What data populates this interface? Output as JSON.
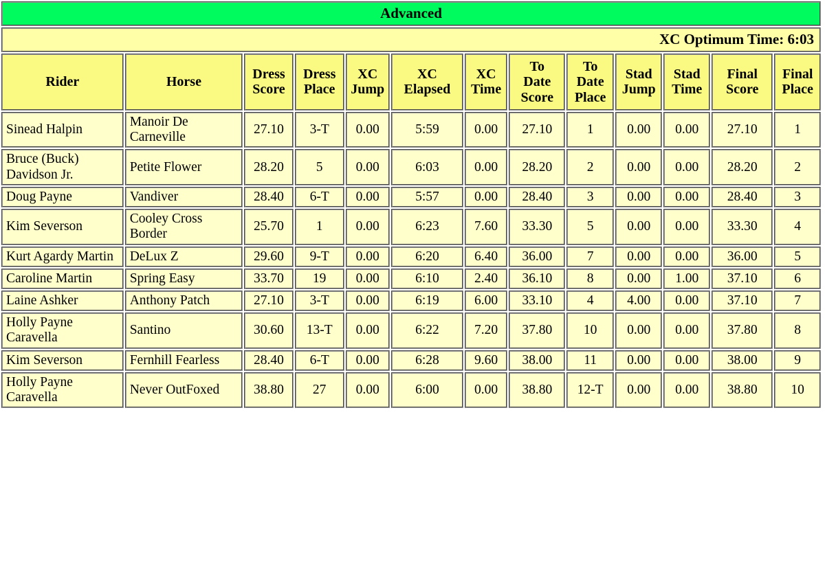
{
  "banner": {
    "division": "Advanced"
  },
  "optimum": {
    "label": "XC Optimum Time: 6:03"
  },
  "table": {
    "columns": [
      "Rider",
      "Horse",
      "Dress Score",
      "Dress Place",
      "XC Jump",
      "XC Elapsed",
      "XC Time",
      "To Date Score",
      "To Date Place",
      "Stad Jump",
      "Stad Time",
      "Final Score",
      "Final Place"
    ],
    "columns_display": [
      {
        "line1": "Rider",
        "line2": ""
      },
      {
        "line1": "Horse",
        "line2": ""
      },
      {
        "line1": "Dress",
        "line2": "Score"
      },
      {
        "line1": "Dress",
        "line2": "Place"
      },
      {
        "line1": "XC",
        "line2": "Jump"
      },
      {
        "line1": "XC",
        "line2": "Elapsed"
      },
      {
        "line1": "XC",
        "line2": "Time"
      },
      {
        "line1": "To",
        "line2": "Date",
        "line3": "Score"
      },
      {
        "line1": "To",
        "line2": "Date",
        "line3": "Place"
      },
      {
        "line1": "Stad",
        "line2": "Jump"
      },
      {
        "line1": "Stad",
        "line2": "Time"
      },
      {
        "line1": "Final",
        "line2": "Score"
      },
      {
        "line1": "Final",
        "line2": "Place"
      }
    ],
    "rows": [
      {
        "rider": "Sinead Halpin",
        "horse": "Manoir De Carneville",
        "dress_score": "27.10",
        "dress_place": "3-T",
        "xc_jump": "0.00",
        "xc_elapsed": "5:59",
        "xc_time": "0.00",
        "to_date_score": "27.10",
        "to_date_place": "1",
        "stad_jump": "0.00",
        "stad_time": "0.00",
        "final_score": "27.10",
        "final_place": "1"
      },
      {
        "rider": "Bruce (Buck) Davidson Jr.",
        "horse": "Petite Flower",
        "dress_score": "28.20",
        "dress_place": "5",
        "xc_jump": "0.00",
        "xc_elapsed": "6:03",
        "xc_time": "0.00",
        "to_date_score": "28.20",
        "to_date_place": "2",
        "stad_jump": "0.00",
        "stad_time": "0.00",
        "final_score": "28.20",
        "final_place": "2"
      },
      {
        "rider": "Doug Payne",
        "horse": "Vandiver",
        "dress_score": "28.40",
        "dress_place": "6-T",
        "xc_jump": "0.00",
        "xc_elapsed": "5:57",
        "xc_time": "0.00",
        "to_date_score": "28.40",
        "to_date_place": "3",
        "stad_jump": "0.00",
        "stad_time": "0.00",
        "final_score": "28.40",
        "final_place": "3"
      },
      {
        "rider": "Kim Severson",
        "horse": "Cooley Cross Border",
        "dress_score": "25.70",
        "dress_place": "1",
        "xc_jump": "0.00",
        "xc_elapsed": "6:23",
        "xc_time": "7.60",
        "to_date_score": "33.30",
        "to_date_place": "5",
        "stad_jump": "0.00",
        "stad_time": "0.00",
        "final_score": "33.30",
        "final_place": "4"
      },
      {
        "rider": "Kurt Agardy Martin",
        "horse": "DeLux Z",
        "dress_score": "29.60",
        "dress_place": "9-T",
        "xc_jump": "0.00",
        "xc_elapsed": "6:20",
        "xc_time": "6.40",
        "to_date_score": "36.00",
        "to_date_place": "7",
        "stad_jump": "0.00",
        "stad_time": "0.00",
        "final_score": "36.00",
        "final_place": "5"
      },
      {
        "rider": "Caroline Martin",
        "horse": "Spring Easy",
        "dress_score": "33.70",
        "dress_place": "19",
        "xc_jump": "0.00",
        "xc_elapsed": "6:10",
        "xc_time": "2.40",
        "to_date_score": "36.10",
        "to_date_place": "8",
        "stad_jump": "0.00",
        "stad_time": "1.00",
        "final_score": "37.10",
        "final_place": "6"
      },
      {
        "rider": "Laine Ashker",
        "horse": "Anthony Patch",
        "dress_score": "27.10",
        "dress_place": "3-T",
        "xc_jump": "0.00",
        "xc_elapsed": "6:19",
        "xc_time": "6.00",
        "to_date_score": "33.10",
        "to_date_place": "4",
        "stad_jump": "4.00",
        "stad_time": "0.00",
        "final_score": "37.10",
        "final_place": "7"
      },
      {
        "rider": "Holly Payne Caravella",
        "horse": "Santino",
        "dress_score": "30.60",
        "dress_place": "13-T",
        "xc_jump": "0.00",
        "xc_elapsed": "6:22",
        "xc_time": "7.20",
        "to_date_score": "37.80",
        "to_date_place": "10",
        "stad_jump": "0.00",
        "stad_time": "0.00",
        "final_score": "37.80",
        "final_place": "8"
      },
      {
        "rider": "Kim Severson",
        "horse": "Fernhill Fearless",
        "dress_score": "28.40",
        "dress_place": "6-T",
        "xc_jump": "0.00",
        "xc_elapsed": "6:28",
        "xc_time": "9.60",
        "to_date_score": "38.00",
        "to_date_place": "11",
        "stad_jump": "0.00",
        "stad_time": "0.00",
        "final_score": "38.00",
        "final_place": "9"
      },
      {
        "rider": "Holly Payne Caravella",
        "horse": "Never OutFoxed",
        "dress_score": "38.80",
        "dress_place": "27",
        "xc_jump": "0.00",
        "xc_elapsed": "6:00",
        "xc_time": "0.00",
        "to_date_score": "38.80",
        "to_date_place": "12-T",
        "stad_jump": "0.00",
        "stad_time": "0.00",
        "final_score": "38.80",
        "final_place": "10"
      }
    ]
  },
  "colors": {
    "division_banner_bg": "#00FB5E",
    "optimum_strip_bg": "#FFFFA8",
    "column_header_bg": "#FAFA82",
    "data_cell_bg": "#FFFFCC",
    "border": "#9A9A9A",
    "text": "#000000"
  }
}
